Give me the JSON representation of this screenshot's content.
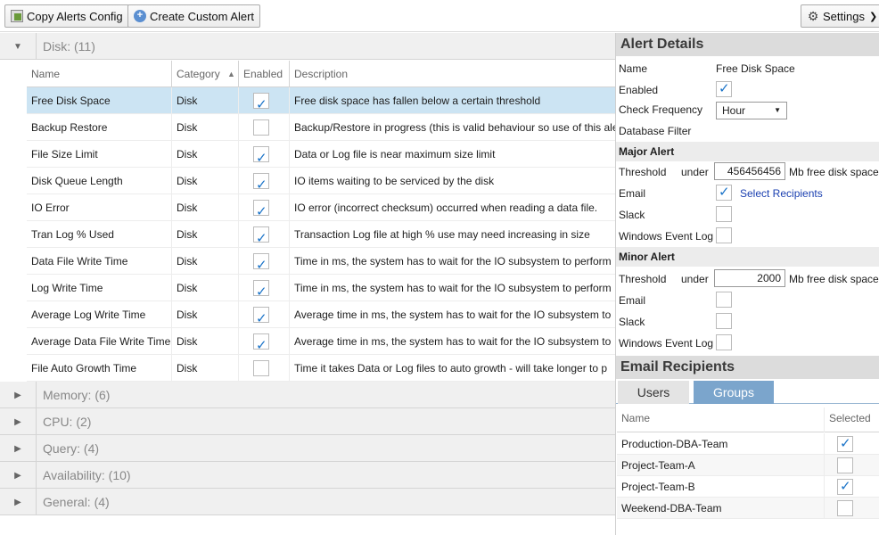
{
  "toolbar": {
    "copy_label": "Copy Alerts Config",
    "create_label": "Create Custom Alert",
    "settings_label": "Settings"
  },
  "grid": {
    "columns": {
      "name": "Name",
      "category": "Category",
      "enabled": "Enabled",
      "description": "Description"
    },
    "groups": [
      {
        "label": "Disk: (11)",
        "expanded": true
      },
      {
        "label": "Memory: (6)",
        "expanded": false
      },
      {
        "label": "CPU: (2)",
        "expanded": false
      },
      {
        "label": "Query: (4)",
        "expanded": false
      },
      {
        "label": "Availability: (10)",
        "expanded": false
      },
      {
        "label": "General: (4)",
        "expanded": false
      }
    ],
    "rows": [
      {
        "name": "Free Disk Space",
        "category": "Disk",
        "enabled": true,
        "description": "Free disk space has fallen below a certain threshold",
        "selected": true
      },
      {
        "name": "Backup Restore",
        "category": "Disk",
        "enabled": false,
        "description": "Backup/Restore in progress (this is valid behaviour so use of this ale"
      },
      {
        "name": "File Size Limit",
        "category": "Disk",
        "enabled": true,
        "description": "Data or Log file is near maximum size limit"
      },
      {
        "name": "Disk Queue Length",
        "category": "Disk",
        "enabled": true,
        "description": "IO items waiting to be serviced by the disk"
      },
      {
        "name": "IO Error",
        "category": "Disk",
        "enabled": true,
        "description": "IO error (incorrect checksum) occurred when reading a data file."
      },
      {
        "name": "Tran Log % Used",
        "category": "Disk",
        "enabled": true,
        "description": "Transaction Log file at high % use may need increasing in size"
      },
      {
        "name": "Data File Write Time",
        "category": "Disk",
        "enabled": true,
        "description": "Time in ms, the system has to wait for the IO subsystem to perform"
      },
      {
        "name": "Log Write Time",
        "category": "Disk",
        "enabled": true,
        "description": "Time in ms, the system has to wait for the IO subsystem to perform"
      },
      {
        "name": "Average Log Write Time",
        "category": "Disk",
        "enabled": true,
        "description": "Average time in ms, the system has to wait for the IO subsystem to"
      },
      {
        "name": "Average Data File Write Time",
        "category": "Disk",
        "enabled": true,
        "description": "Average time in ms, the system has to wait for the IO subsystem to"
      },
      {
        "name": "File Auto Growth Time",
        "category": "Disk",
        "enabled": false,
        "description": "Time it takes Data or Log files to auto growth - will take longer to p"
      }
    ]
  },
  "details": {
    "title": "Alert Details",
    "name_label": "Name",
    "name_value": "Free Disk Space",
    "enabled_label": "Enabled",
    "enabled": true,
    "freq_label": "Check Frequency",
    "freq_value": "Hour",
    "db_filter_label": "Database Filter",
    "major": {
      "title": "Major Alert",
      "threshold_label": "Threshold",
      "under": "under",
      "threshold_value": "456456456",
      "unit": "Mb free disk space",
      "email_label": "Email",
      "email": true,
      "select_recipients": "Select Recipients",
      "slack_label": "Slack",
      "slack": false,
      "wel_label": "Windows Event Log",
      "wel": false
    },
    "minor": {
      "title": "Minor Alert",
      "threshold_label": "Threshold",
      "under": "under",
      "threshold_value": "2000",
      "unit": "Mb free disk space",
      "email_label": "Email",
      "email": false,
      "slack_label": "Slack",
      "slack": false,
      "wel_label": "Windows Event Log",
      "wel": false
    }
  },
  "recipients": {
    "title": "Email Recipients",
    "tabs": [
      "Users",
      "Groups"
    ],
    "active_tab": "Groups",
    "col_name": "Name",
    "col_selected": "Selected",
    "rows": [
      {
        "name": "Production-DBA-Team",
        "selected": true
      },
      {
        "name": "Project-Team-A",
        "selected": false
      },
      {
        "name": "Project-Team-B",
        "selected": true
      },
      {
        "name": "Weekend-DBA-Team",
        "selected": false
      }
    ]
  }
}
